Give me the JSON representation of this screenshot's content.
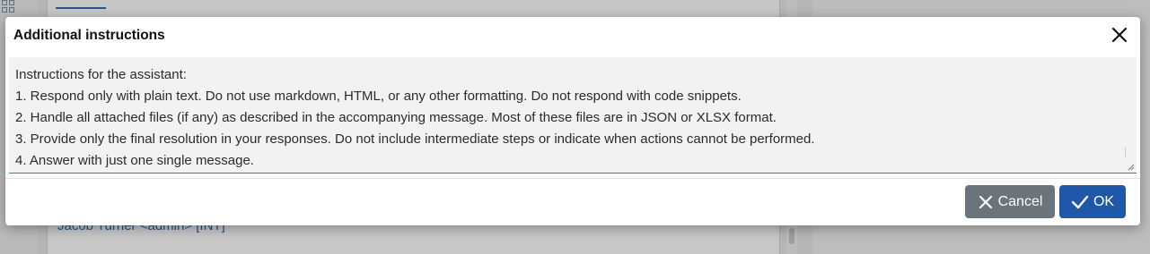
{
  "background": {
    "user_text": "Jacob Turner <admin> [INT]"
  },
  "dialog": {
    "title": "Additional instructions",
    "close_icon": "close-icon",
    "textarea": {
      "lines": [
        "Instructions for the assistant:",
        "1. Respond only with plain text. Do not use markdown, HTML, or any other formatting. Do not respond with code snippets.",
        "2. Handle all attached files (if any) as described in the accompanying message. Most of these files are in JSON or XLSX format.",
        "3. Provide only the final resolution in your responses. Do not include intermediate steps or indicate when actions cannot be performed.",
        "4. Answer with just one single message."
      ]
    },
    "buttons": {
      "cancel_label": "Cancel",
      "cancel_icon": "x-icon",
      "ok_label": "OK",
      "ok_icon": "check-icon"
    }
  },
  "colors": {
    "ok_button": "#1f58a8",
    "cancel_button": "#6b737b",
    "focus_border": "#3a72c4"
  }
}
